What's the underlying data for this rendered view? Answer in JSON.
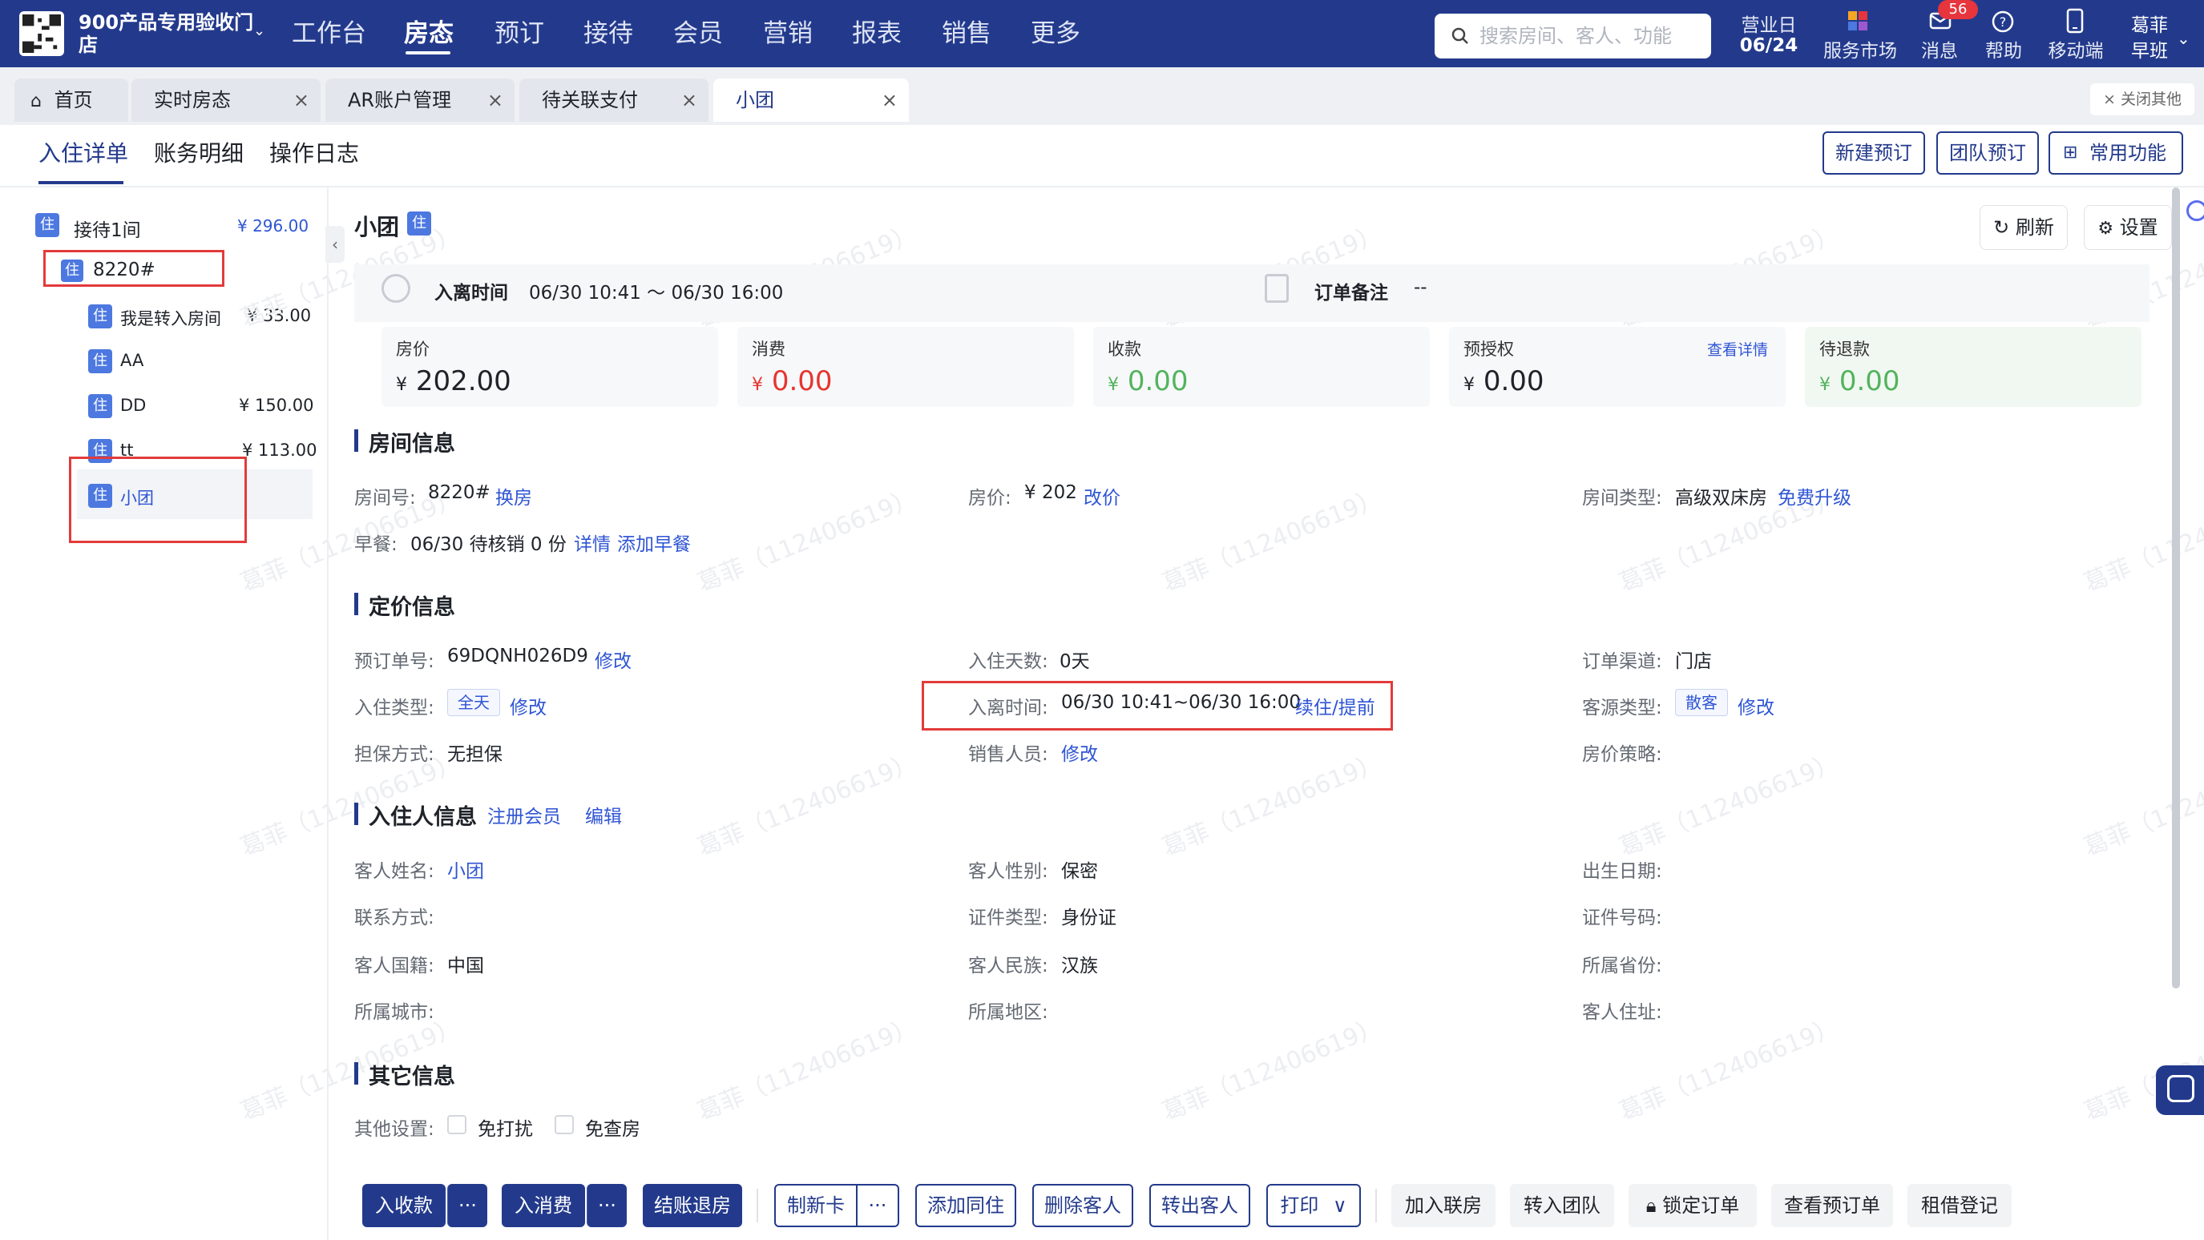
{
  "header": {
    "store_name": "900产品专用验收门店",
    "nav": [
      "工作台",
      "房态",
      "预订",
      "接待",
      "会员",
      "营销",
      "报表",
      "销售",
      "更多"
    ],
    "active_nav": "房态",
    "search_placeholder": "搜索房间、客人、功能",
    "biz_day_label": "营业日",
    "biz_day": "06/24",
    "service_market": "服务市场",
    "messages": "消息",
    "messages_badge": "56",
    "help": "帮助",
    "mobile": "移动端",
    "user_name": "葛菲",
    "user_shift": "早班"
  },
  "tabs": [
    {
      "label": "首页",
      "closable": false
    },
    {
      "label": "实时房态",
      "closable": true
    },
    {
      "label": "AR账户管理",
      "closable": true
    },
    {
      "label": "待关联支付",
      "closable": true
    },
    {
      "label": "小团",
      "closable": true,
      "active": true
    }
  ],
  "close_others": "× 关闭其他",
  "subtabs": [
    "入住详单",
    "账务明细",
    "操作日志"
  ],
  "top_actions": [
    "新建预订",
    "团队预订",
    "常用功能"
  ],
  "tree": {
    "group_label": "接待1间",
    "group_amount": "¥ 296.00",
    "room": "8220#",
    "guests": [
      {
        "name": "我是转入房间",
        "amount": "¥ 33.00"
      },
      {
        "name": "AA",
        "amount": ""
      },
      {
        "name": "DD",
        "amount": "¥ 150.00"
      },
      {
        "name": "tt",
        "amount": "¥ 113.00"
      },
      {
        "name": "小团",
        "amount": ""
      }
    ],
    "badge": "住"
  },
  "main": {
    "title": "小团",
    "title_badge": "住",
    "refresh": "刷新",
    "settings": "设置",
    "stay_label": "入离时间",
    "stay_value": "06/30 10:41 ～ 06/30 16:00",
    "order_note_label": "订单备注",
    "order_note_value": "--",
    "cards": [
      {
        "label": "房价",
        "currency": "¥",
        "value": "202.00"
      },
      {
        "label": "消费",
        "currency": "¥",
        "value": "0.00"
      },
      {
        "label": "收款",
        "currency": "¥",
        "value": "0.00"
      },
      {
        "label": "预授权",
        "currency": "¥",
        "value": "0.00",
        "link": "查看详情"
      },
      {
        "label": "待退款",
        "currency": "¥",
        "value": "0.00"
      }
    ]
  },
  "room_info": {
    "title": "房间信息",
    "room_no_label": "房间号:",
    "room_no": "8220#",
    "room_no_link": "换房",
    "price_label": "房价:",
    "price": "¥ 202",
    "price_link": "改价",
    "type_label": "房间类型:",
    "type": "高级双床房",
    "type_link": "免费升级",
    "breakfast_label": "早餐:",
    "breakfast": "06/30 待核销 0 份",
    "breakfast_link1": "详情",
    "breakfast_link2": "添加早餐"
  },
  "pricing_info": {
    "title": "定价信息",
    "order_no_label": "预订单号:",
    "order_no": "69DQNH026D9",
    "order_no_link": "修改",
    "days_label": "入住天数:",
    "days": "0天",
    "channel_label": "订单渠道:",
    "channel": "门店",
    "checkin_type_label": "入住类型:",
    "checkin_type": "全天",
    "checkin_type_link": "修改",
    "stay_label": "入离时间:",
    "stay": "06/30 10:41~06/30 16:00",
    "stay_link": "续住/提前",
    "source_label": "客源类型:",
    "source": "散客",
    "source_link": "修改",
    "guarantee_label": "担保方式:",
    "guarantee": "无担保",
    "sales_label": "销售人员:",
    "sales_link": "修改",
    "strategy_label": "房价策略:"
  },
  "guest_info": {
    "title": "入住人信息",
    "register_link": "注册会员",
    "edit_link": "编辑",
    "name_label": "客人姓名:",
    "name": "小团",
    "gender_label": "客人性别:",
    "gender": "保密",
    "birth_label": "出生日期:",
    "contact_label": "联系方式:",
    "id_type_label": "证件类型:",
    "id_type": "身份证",
    "id_no_label": "证件号码:",
    "nationality_label": "客人国籍:",
    "nationality": "中国",
    "ethnicity_label": "客人民族:",
    "ethnicity": "汉族",
    "province_label": "所属省份:",
    "city_label": "所属城市:",
    "district_label": "所属地区:",
    "address_label": "客人住址:"
  },
  "other_info": {
    "title": "其它信息",
    "settings_label": "其他设置:",
    "dnd": "免打扰",
    "no_check": "免查房"
  },
  "bottom": {
    "receive": "入收款",
    "consume": "入消费",
    "checkout": "结账退房",
    "make_card": "制新卡",
    "add_cohabit": "添加同住",
    "delete_guest": "删除客人",
    "transfer_guest": "转出客人",
    "print": "打印",
    "join_link": "加入联房",
    "to_team": "转入团队",
    "lock_order": "锁定订单",
    "view_booking": "查看预订单",
    "rent_register": "租借登记",
    "more": "···"
  },
  "watermark": "葛菲（112406619）",
  "colors": {
    "primary": "#233a8c",
    "link": "#2f55d4",
    "red": "#e5352f",
    "green": "#53b35e",
    "highlight": "#e23b3b"
  }
}
